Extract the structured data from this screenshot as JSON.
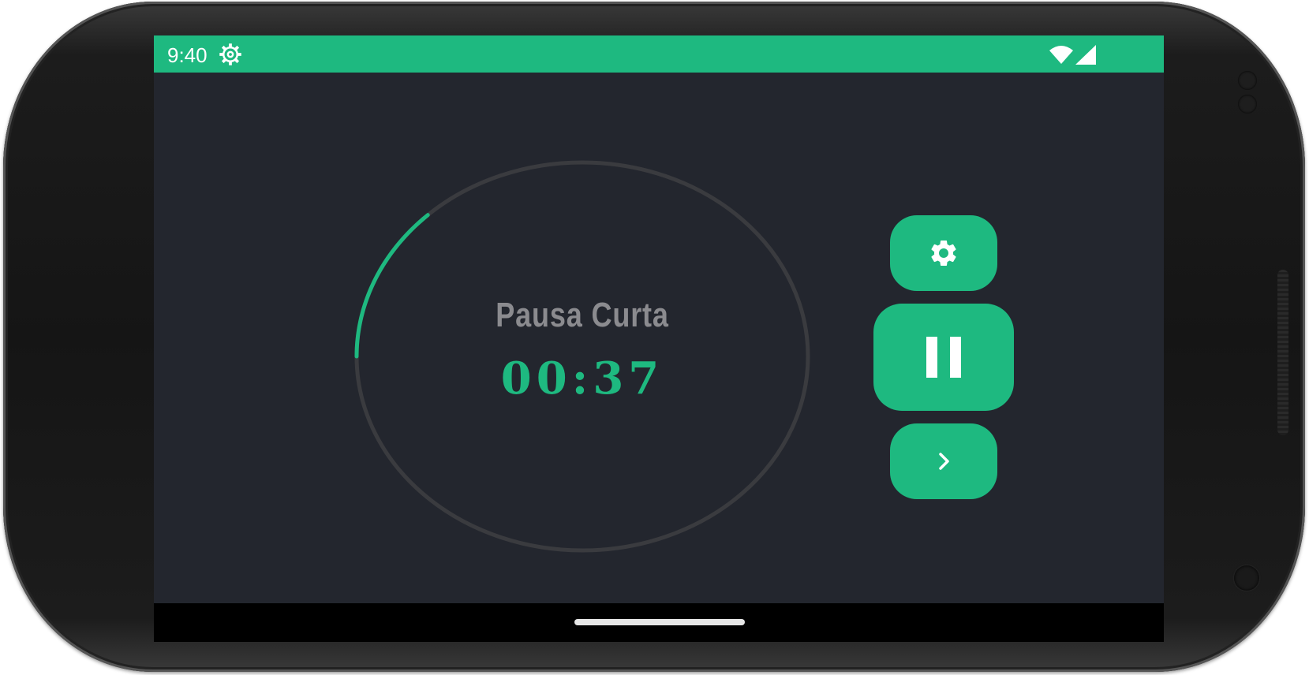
{
  "status_bar": {
    "time": "9:40",
    "background_color": "#1eb980",
    "left_icon": "settings-gear-icon",
    "right_icons": [
      "wifi-icon",
      "cellular-signal-icon"
    ]
  },
  "timer": {
    "mode_label": "Pausa Curta",
    "time_remaining": "00:37",
    "progress_fraction": 0.13,
    "accent_color": "#1eb980",
    "label_color": "#8b8b8f",
    "track_color": "#3a3b3f"
  },
  "controls": {
    "settings_icon": "gear-icon",
    "pause_icon": "pause-icon",
    "skip_icon": "chevron-right-icon"
  },
  "colors": {
    "screen_background": "#23262e",
    "nav_bar_background": "#000000"
  }
}
